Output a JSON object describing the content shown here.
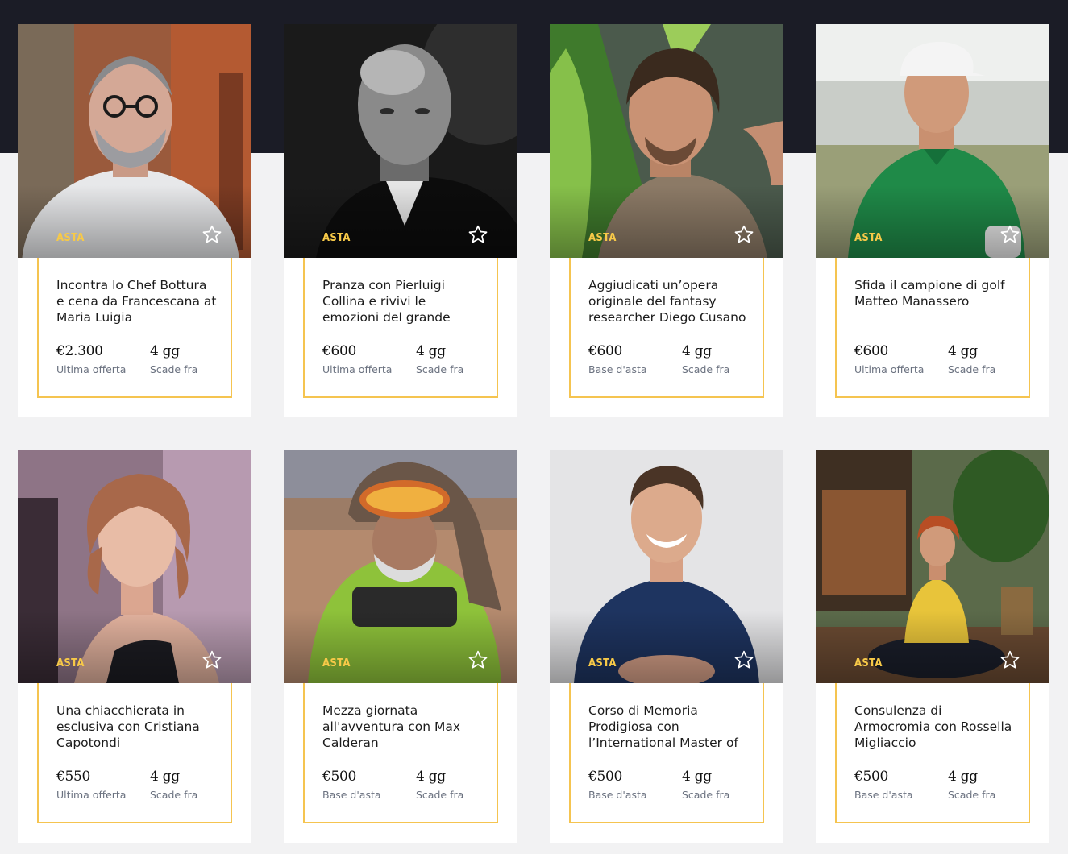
{
  "colors": {
    "header_band": "#1b1c26",
    "background": "#f2f2f3",
    "accent": "#f5c450",
    "badge": "#f7c948"
  },
  "cards": [
    {
      "badge": "ASTA",
      "favorite_icon": "star-outline-icon",
      "title": "Incontra lo Chef Bottura e cena da Francescana at Maria Luigia",
      "price": "€2.300",
      "price_label": "Ultima offerta",
      "time": "4 gg",
      "time_label": "Scade fra"
    },
    {
      "badge": "ASTA",
      "favorite_icon": "star-outline-icon",
      "title": "Pranza con Pierluigi Collina e rivivi le emozioni del grande",
      "price": "€600",
      "price_label": "Ultima offerta",
      "time": "4 gg",
      "time_label": "Scade fra"
    },
    {
      "badge": "ASTA",
      "favorite_icon": "star-outline-icon",
      "title": "Aggiudicati un’opera originale del fantasy researcher Diego Cusano",
      "price": "€600",
      "price_label": "Base d'asta",
      "time": "4 gg",
      "time_label": "Scade fra"
    },
    {
      "badge": "ASTA",
      "favorite_icon": "star-outline-icon",
      "title": "Sfida il campione di golf Matteo Manassero",
      "price": "€600",
      "price_label": "Ultima offerta",
      "time": "4 gg",
      "time_label": "Scade fra"
    },
    {
      "badge": "ASTA",
      "favorite_icon": "star-outline-icon",
      "title": "Una chiacchierata in esclusiva con Cristiana Capotondi",
      "price": "€550",
      "price_label": "Ultima offerta",
      "time": "4 gg",
      "time_label": "Scade fra"
    },
    {
      "badge": "ASTA",
      "favorite_icon": "star-outline-icon",
      "title": "Mezza giornata all'avventura con Max Calderan",
      "price": "€500",
      "price_label": "Base d'asta",
      "time": "4 gg",
      "time_label": "Scade fra"
    },
    {
      "badge": "ASTA",
      "favorite_icon": "star-outline-icon",
      "title": "Corso di Memoria Prodigiosa con l’International Master of",
      "price": "€500",
      "price_label": "Base d'asta",
      "time": "4 gg",
      "time_label": "Scade fra"
    },
    {
      "badge": "ASTA",
      "favorite_icon": "star-outline-icon",
      "title": "Consulenza di Armocromia con Rossella Migliaccio",
      "price": "€500",
      "price_label": "Base d'asta",
      "time": "4 gg",
      "time_label": "Scade fra"
    }
  ]
}
